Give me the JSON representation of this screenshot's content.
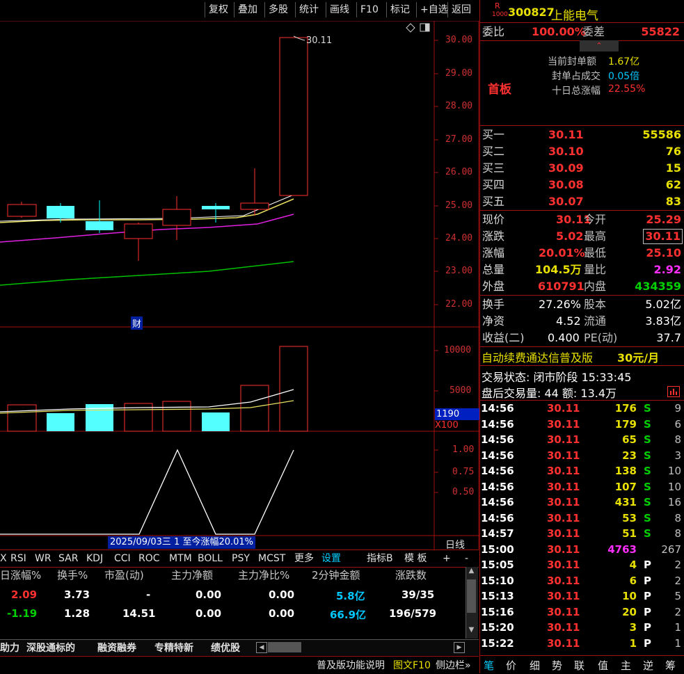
{
  "toolbar": {
    "items": [
      "复权",
      "叠加",
      "多股",
      "统计",
      "画线",
      "F10",
      "标记",
      "+自选",
      "返回"
    ]
  },
  "chart": {
    "price_axis": [
      "30.00",
      "29.00",
      "28.00",
      "27.00",
      "26.00",
      "25.00",
      "24.00",
      "23.00",
      "22.00"
    ],
    "last_label": "30.11",
    "cai_label": "财",
    "vol_axis": [
      "10000",
      "5000"
    ],
    "vol_current": "1190",
    "vol_unit": "X100",
    "ind_axis": [
      "1.00",
      "0.75",
      "0.50"
    ],
    "date_info": "2025/09/03三 1 至今涨幅20.01%",
    "period": "日线"
  },
  "stock": {
    "badge_r": "R",
    "badge_num": "1000",
    "code": "300827",
    "name": "上能电气"
  },
  "weibi": {
    "label": "委比",
    "value": "100.00%",
    "label2": "委差",
    "value2": "55822"
  },
  "seal": {
    "tag": "首板",
    "rows": [
      {
        "label": "当前封单额",
        "value": "1.67亿"
      },
      {
        "label": "封单占成交",
        "value": "0.05倍"
      },
      {
        "label": "十日总涨幅",
        "value": "22.55%"
      }
    ]
  },
  "bids": [
    {
      "label": "买一",
      "price": "30.11",
      "vol": "55586"
    },
    {
      "label": "买二",
      "price": "30.10",
      "vol": "76"
    },
    {
      "label": "买三",
      "price": "30.09",
      "vol": "15"
    },
    {
      "label": "买四",
      "price": "30.08",
      "vol": "62"
    },
    {
      "label": "买五",
      "price": "30.07",
      "vol": "83"
    }
  ],
  "quote": [
    {
      "l1": "现价",
      "v1": "30.11",
      "l2": "今开",
      "v2": "25.29"
    },
    {
      "l1": "涨跌",
      "v1": "5.02",
      "l2": "最高",
      "v2": "30.11"
    },
    {
      "l1": "涨幅",
      "v1": "20.01%",
      "l2": "最低",
      "v2": "25.10"
    },
    {
      "l1": "总量",
      "v1": "104.5万",
      "l2": "量比",
      "v2": "2.92"
    },
    {
      "l1": "外盘",
      "v1": "610791",
      "l2": "内盘",
      "v2": "434359"
    }
  ],
  "fund": [
    {
      "l1": "换手",
      "v1": "27.26%",
      "l2": "股本",
      "v2": "5.02亿"
    },
    {
      "l1": "净资",
      "v1": "4.52",
      "l2": "流通",
      "v2": "3.83亿"
    },
    {
      "l1": "收益(二)",
      "v1": "0.400",
      "l2": "PE(动)",
      "v2": "37.7"
    }
  ],
  "ad": {
    "text": "自动续费通达信普及版",
    "price": "30元/月"
  },
  "trade": {
    "status": "交易状态: 闭市阶段 15:33:45",
    "after": "盘后交易量: 44  额: 13.4万"
  },
  "ticks": [
    {
      "t": "14:56",
      "p": "30.11",
      "v": "176",
      "d": "S",
      "n": "9"
    },
    {
      "t": "14:56",
      "p": "30.11",
      "v": "179",
      "d": "S",
      "n": "6"
    },
    {
      "t": "14:56",
      "p": "30.11",
      "v": "65",
      "d": "S",
      "n": "8"
    },
    {
      "t": "14:56",
      "p": "30.11",
      "v": "23",
      "d": "S",
      "n": "3"
    },
    {
      "t": "14:56",
      "p": "30.11",
      "v": "138",
      "d": "S",
      "n": "10"
    },
    {
      "t": "14:56",
      "p": "30.11",
      "v": "107",
      "d": "S",
      "n": "10"
    },
    {
      "t": "14:56",
      "p": "30.11",
      "v": "431",
      "d": "S",
      "n": "16"
    },
    {
      "t": "14:56",
      "p": "30.11",
      "v": "53",
      "d": "S",
      "n": "8"
    },
    {
      "t": "14:57",
      "p": "30.11",
      "v": "51",
      "d": "S",
      "n": "8"
    },
    {
      "t": "15:00",
      "p": "30.11",
      "v": "4763",
      "d": "",
      "n": "267"
    },
    {
      "t": "15:05",
      "p": "30.11",
      "v": "4",
      "d": "P",
      "n": "2"
    },
    {
      "t": "15:10",
      "p": "30.11",
      "v": "6",
      "d": "P",
      "n": "2"
    },
    {
      "t": "15:13",
      "p": "30.11",
      "v": "10",
      "d": "P",
      "n": "5"
    },
    {
      "t": "15:16",
      "p": "30.11",
      "v": "20",
      "d": "P",
      "n": "2"
    },
    {
      "t": "15:20",
      "p": "30.11",
      "v": "3",
      "P": "",
      "d": "P",
      "n": "1"
    },
    {
      "t": "15:22",
      "p": "30.11",
      "v": "1",
      "d": "P",
      "n": "1"
    }
  ],
  "indicator_tabs": [
    "X",
    "RSI",
    "WR",
    "SAR",
    "KDJ",
    "CCI",
    "ROC",
    "MTM",
    "BOLL",
    "PSY",
    "MCST",
    "更多",
    "设置",
    "指标B",
    "模 板",
    "+",
    "-"
  ],
  "table": {
    "headers": [
      "日涨幅%",
      "换手%",
      "市盈(动)",
      "主力净额",
      "主力净比%",
      "2分钟金额",
      "涨跌数"
    ],
    "rows": [
      [
        "2.09",
        "3.73",
        "-",
        "0.00",
        "0.00",
        "5.8亿",
        "39/35"
      ],
      [
        "-1.19",
        "1.28",
        "14.51",
        "0.00",
        "0.00",
        "66.9亿",
        "196/579"
      ]
    ]
  },
  "bottom_tabs": [
    "助力",
    "深股通标的",
    "融资融券",
    "专精特新",
    "绩优股"
  ],
  "status_bar": [
    "普及版功能说明",
    "图文F10",
    "侧边栏»"
  ],
  "right_tabs": [
    "笔",
    "价",
    "细",
    "势",
    "联",
    "值",
    "主",
    "逆",
    "筹"
  ]
}
